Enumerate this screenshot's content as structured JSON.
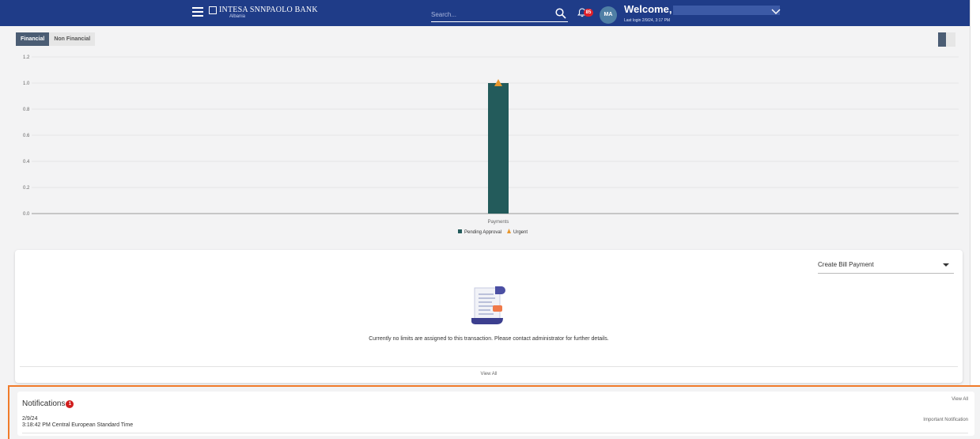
{
  "header": {
    "bank_name": "INTESA SNNPAOLO BANK",
    "bank_country": "Albania",
    "search_placeholder": "Search...",
    "notification_count": "85",
    "avatar_initials": "MA",
    "welcome": "Welcome,",
    "last_login": "Last login 2/9/24, 3:17 PM"
  },
  "tabs": {
    "financial": "Financial",
    "non_financial": "Non Financial"
  },
  "chart_data": {
    "type": "bar",
    "categories": [
      "Payments"
    ],
    "series": [
      {
        "name": "Pending Approval",
        "values": [
          1.0
        ],
        "color": "#235b5b"
      },
      {
        "name": "Urgent",
        "values": [
          1.0
        ],
        "color": "#e8962b",
        "marker": "triangle"
      }
    ],
    "yticks": [
      "0.0",
      "0.2",
      "0.4",
      "0.6",
      "0.8",
      "1.0",
      "1.2"
    ],
    "ylim": [
      0,
      1.2
    ],
    "grid": true,
    "legend": "bottom-center"
  },
  "limits_card": {
    "select_value": "Create Bill Payment",
    "message": "Currently no limits are assigned to this transaction. Please contact administrator for further details.",
    "view_all": "View All"
  },
  "notifications": {
    "title": "Notifications",
    "badge": "1",
    "view_all": "View All",
    "items": [
      {
        "date": "2/9/24",
        "time": "3:18:42 PM Central European Standard Time",
        "label": "Important Notification"
      }
    ]
  }
}
